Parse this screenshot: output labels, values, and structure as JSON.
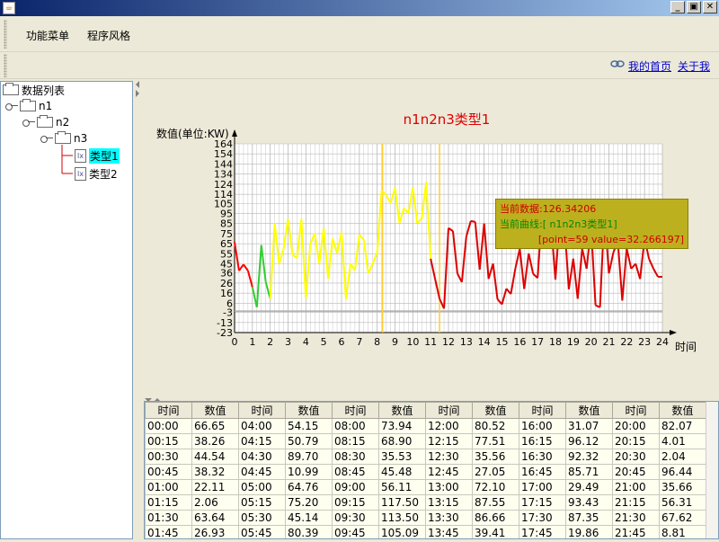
{
  "window": {
    "minimize_label": "_",
    "restore_label": "▣",
    "close_label": "✕"
  },
  "menu": {
    "items": [
      "功能菜单",
      "程序风格"
    ]
  },
  "toolbar": {
    "home_link": "我的首页",
    "about_link": "关于我"
  },
  "tree": {
    "root": "数据列表",
    "n1": "n1",
    "n2": "n2",
    "n3": "n3",
    "leaf1": "类型1",
    "leaf2": "类型2"
  },
  "tooltip": {
    "current_data_label": "当前数据:126.34206",
    "current_curve_label": "当前曲线:[ n1n2n3类型1]",
    "point_label": "[point=59 value=32.266197]"
  },
  "chart_data": {
    "type": "line",
    "title": "n1n2n3类型1",
    "ylabel": "数值(单位:KW)",
    "xlabel": "时间",
    "ylim": [
      -23,
      164
    ],
    "xlim": [
      0,
      24
    ],
    "yticks": [
      164,
      154,
      144,
      134,
      124,
      114,
      105,
      95,
      85,
      75,
      65,
      55,
      45,
      36,
      26,
      16,
      6,
      -3,
      -13,
      -23
    ],
    "xticks": [
      0,
      1,
      2,
      3,
      4,
      5,
      6,
      7,
      8,
      9,
      10,
      11,
      12,
      13,
      14,
      15,
      16,
      17,
      18,
      19,
      20,
      21,
      22,
      23,
      24
    ],
    "grid": true,
    "vertical_markers": [
      8.3,
      11.5
    ],
    "baseline": 0,
    "colors": {
      "segment1": "#ff0000",
      "segment2": "#33cc33",
      "segment3": "#ffff00",
      "segment4": "#dd0000",
      "title": "#dd0000",
      "marker": "#ffcc33",
      "baseline": "#aaaaaa"
    },
    "series": [
      {
        "x": [
          0,
          0.25,
          0.5,
          0.75,
          1,
          1.25,
          1.5,
          1.75,
          2,
          2.25,
          2.5,
          2.75,
          3,
          3.25,
          3.5,
          3.75,
          4,
          4.25,
          4.5,
          4.75,
          5,
          5.25,
          5.5,
          5.75,
          6,
          6.25,
          6.5,
          6.75,
          7,
          7.25,
          7.5,
          7.75,
          8,
          8.25,
          8.5,
          8.75,
          9,
          9.25,
          9.5,
          9.75,
          10,
          10.25,
          10.5,
          10.75,
          11,
          11.25,
          11.5,
          11.75,
          12,
          12.25,
          12.5,
          12.75,
          13,
          13.25,
          13.5,
          13.75,
          14,
          14.25,
          14.5,
          14.75,
          15,
          15.25,
          15.5,
          15.75,
          16,
          16.25,
          16.5,
          16.75,
          17,
          17.25,
          17.5,
          17.75,
          18,
          18.25,
          18.5,
          18.75,
          19,
          19.25,
          19.5,
          19.75,
          20,
          20.25,
          20.5,
          20.75,
          21,
          21.25,
          21.5,
          21.75,
          22,
          22.25,
          22.5,
          22.75,
          23,
          23.25,
          23.5,
          23.75,
          24
        ],
        "values": [
          66.65,
          38.26,
          44.54,
          38.32,
          22.11,
          2.06,
          63.64,
          26.93,
          10.5,
          85,
          45.2,
          60,
          89.7,
          54.15,
          50.79,
          89.7,
          10.99,
          64.76,
          75.2,
          45.14,
          80.39,
          30.5,
          70.1,
          55.3,
          76.2,
          10.2,
          45.5,
          38.6,
          73.94,
          68.9,
          35.53,
          45.48,
          56.11,
          117.5,
          113.5,
          105.09,
          120.2,
          85.4,
          100.1,
          95.2,
          120.5,
          85.3,
          90.2,
          126.34,
          50.2,
          30.1,
          10.5,
          0.8,
          80.52,
          77.51,
          35.56,
          27.05,
          72.1,
          87.55,
          86.66,
          39.41,
          85,
          30.2,
          45.3,
          10.1,
          5,
          20.5,
          15.2,
          40.3,
          60.1,
          20.2,
          55.4,
          35.2,
          31.07,
          96.12,
          92.32,
          85.71,
          29.49,
          93.43,
          87.35,
          19.86,
          50.2,
          10.5,
          60.3,
          40.2,
          82.07,
          4.01,
          2.04,
          96.44,
          35.66,
          56.31,
          67.62,
          8.81,
          60.2,
          40.3,
          45.2,
          30.1,
          70.2,
          50.1,
          40.3,
          32.27,
          32.27
        ]
      }
    ]
  },
  "table": {
    "headers": [
      "时间",
      "数值",
      "时间",
      "数值",
      "时间",
      "数值",
      "时间",
      "数值",
      "时间",
      "数值",
      "时间",
      "数值"
    ],
    "rows": [
      [
        "00:00",
        "66.65",
        "04:00",
        "54.15",
        "08:00",
        "73.94",
        "12:00",
        "80.52",
        "16:00",
        "31.07",
        "20:00",
        "82.07"
      ],
      [
        "00:15",
        "38.26",
        "04:15",
        "50.79",
        "08:15",
        "68.90",
        "12:15",
        "77.51",
        "16:15",
        "96.12",
        "20:15",
        "4.01"
      ],
      [
        "00:30",
        "44.54",
        "04:30",
        "89.70",
        "08:30",
        "35.53",
        "12:30",
        "35.56",
        "16:30",
        "92.32",
        "20:30",
        "2.04"
      ],
      [
        "00:45",
        "38.32",
        "04:45",
        "10.99",
        "08:45",
        "45.48",
        "12:45",
        "27.05",
        "16:45",
        "85.71",
        "20:45",
        "96.44"
      ],
      [
        "01:00",
        "22.11",
        "05:00",
        "64.76",
        "09:00",
        "56.11",
        "13:00",
        "72.10",
        "17:00",
        "29.49",
        "21:00",
        "35.66"
      ],
      [
        "01:15",
        "2.06",
        "05:15",
        "75.20",
        "09:15",
        "117.50",
        "13:15",
        "87.55",
        "17:15",
        "93.43",
        "21:15",
        "56.31"
      ],
      [
        "01:30",
        "63.64",
        "05:30",
        "45.14",
        "09:30",
        "113.50",
        "13:30",
        "86.66",
        "17:30",
        "87.35",
        "21:30",
        "67.62"
      ],
      [
        "01:45",
        "26.93",
        "05:45",
        "80.39",
        "09:45",
        "105.09",
        "13:45",
        "39.41",
        "17:45",
        "19.86",
        "21:45",
        "8.81"
      ]
    ]
  }
}
